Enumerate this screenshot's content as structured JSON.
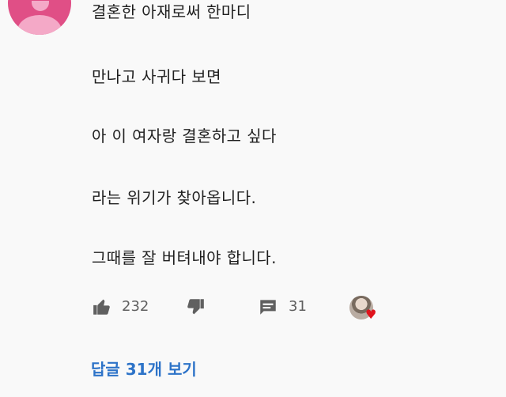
{
  "comment": {
    "lines": [
      "결혼한 아재로써 한마디",
      "만나고 사귀다 보면",
      "아 이 여자랑 결혼하고 싶다",
      "라는 위기가 찾아옵니다.",
      "그때를 잘 버텨내야 합니다."
    ],
    "likes": "232",
    "replies_count": "31",
    "view_replies_label": "답글 31개 보기",
    "icons": {
      "avatar": "user-avatar-icon",
      "like": "thumbs-up-icon",
      "dislike": "thumbs-down-icon",
      "reply": "reply-comment-icon",
      "creator_heart": "creator-heart-icon"
    },
    "colors": {
      "avatar_background": "#e04f86",
      "link_blue": "#2d73c8",
      "heart_red": "#e0131c",
      "icon_gray": "#606060"
    }
  }
}
